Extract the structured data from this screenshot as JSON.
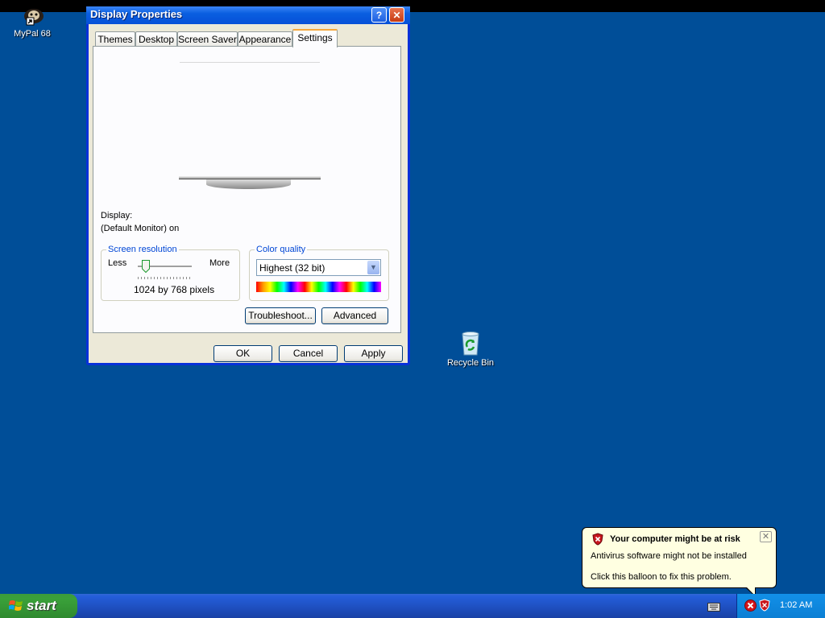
{
  "window": {
    "title": "Display Properties",
    "help_glyph": "?",
    "close_glyph": "✕"
  },
  "tabs": [
    {
      "label": "Themes"
    },
    {
      "label": "Desktop"
    },
    {
      "label": "Screen Saver"
    },
    {
      "label": "Appearance"
    },
    {
      "label": "Settings",
      "active": true
    }
  ],
  "settings": {
    "display_label": "Display:",
    "display_value": "(Default Monitor) on",
    "resolution": {
      "group_label": "Screen resolution",
      "less_label": "Less",
      "more_label": "More",
      "value_text": "1024 by 768 pixels"
    },
    "color_quality": {
      "group_label": "Color quality",
      "selected": "Highest (32 bit)",
      "arrow_glyph": "▼"
    },
    "troubleshoot_label": "Troubleshoot...",
    "advanced_label": "Advanced"
  },
  "buttons": {
    "ok": "OK",
    "cancel": "Cancel",
    "apply": "Apply"
  },
  "desktop": {
    "icons": [
      {
        "label": "MyPal 68"
      },
      {
        "label": "Recycle Bin"
      }
    ]
  },
  "taskbar": {
    "start_label": "start",
    "clock": "1:02 AM"
  },
  "balloon": {
    "title": "Your computer might be at risk",
    "line1": "Antivirus software might not be installed",
    "line2": "Click this balloon to fix this problem.",
    "close_glyph": "✕"
  },
  "colors": {
    "desktop": "#004e98",
    "titlebar": "#0a5fe0",
    "dialog_face": "#ece9d8",
    "start_green": "#3aa13a",
    "balloon_bg": "#ffffe1",
    "tab_highlight": "#f5a83b"
  }
}
